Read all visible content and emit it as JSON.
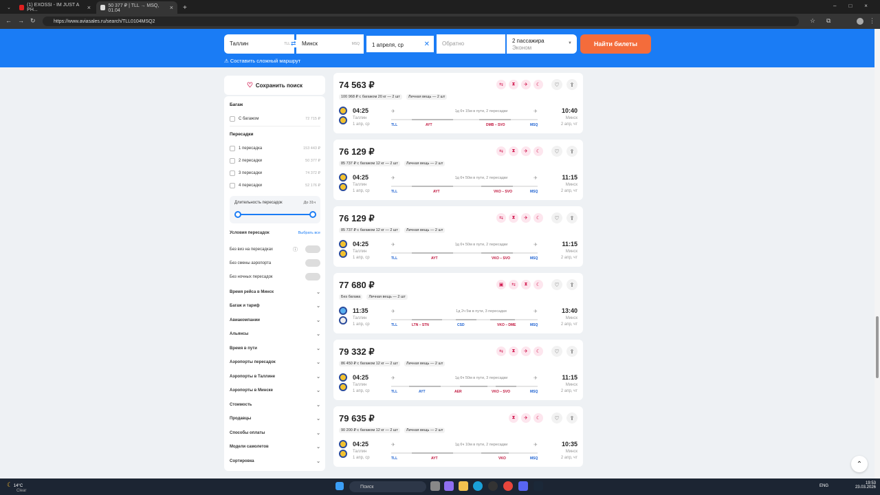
{
  "browser": {
    "tabs": [
      {
        "label": "(1) EXOSSI - IM JUST A PH..."
      },
      {
        "label": "50 377 ₽ | TLL → MSQ, 01.04"
      }
    ],
    "url": "https://www.aviasales.ru/search/TLL0104MSQ2"
  },
  "search": {
    "from": "Таллин",
    "from_code": "TLL",
    "to": "Минск",
    "to_code": "MSQ",
    "date": "1 апреля, ср",
    "return_placeholder": "Обратно",
    "passengers": "2 пассажира",
    "class": "Эконом",
    "button": "Найти билеты",
    "complex": "Составить сложный маршрут"
  },
  "sidebar": {
    "save": "Сохранить поиск",
    "baggage_title": "Багаж",
    "baggage": [
      {
        "label": "С багажом",
        "count": "72 715 ₽"
      }
    ],
    "transfers_title": "Пересадки",
    "transfers": [
      {
        "label": "1 пересадка",
        "count": "153 443 ₽"
      },
      {
        "label": "2 пересадки",
        "count": "50 377 ₽"
      },
      {
        "label": "3 пересадки",
        "count": "74 372 ₽"
      },
      {
        "label": "4 пересадки",
        "count": "52 176 ₽"
      }
    ],
    "duration_label": "Длительность пересадок",
    "duration_value": "До 31ч",
    "conditions_title": "Условия пересадок",
    "select_all": "Выбрать все",
    "conditions": [
      {
        "label": "Без виз на пересадках"
      },
      {
        "label": "Без смены аэропорта"
      },
      {
        "label": "Без ночных пересадок"
      }
    ],
    "sections": [
      "Время рейса в Минск",
      "Багаж и тариф",
      "Авиакомпании",
      "Альянсы",
      "Время в пути",
      "Аэропорты пересадок",
      "Аэропорты в Таллине",
      "Аэропорты в Минске",
      "Стоимость",
      "Продавцы",
      "Способы оплаты",
      "Модели самолетов",
      "Сортировка"
    ]
  },
  "tickets": [
    {
      "price": "74 563 ₽",
      "bag": "100 968 ₽ с багажом 20 кг — 2 шт",
      "hand": "Личная вещь — 2 шт",
      "dep": "04:25",
      "arr": "10:40",
      "city1": "Таллин",
      "city2": "Минск",
      "date1": "1 апр, ср",
      "date2": "2 апр, чт",
      "dur": "1д 6ч 15м в пути, 2 пересадки",
      "ap": [
        "TLL",
        "AYT",
        "DMB – SVO",
        "MSQ"
      ]
    },
    {
      "price": "76 129 ₽",
      "bag": "85 737 ₽ с багажом 12 кг — 2 шт",
      "hand": "Личная вещь — 2 шт",
      "dep": "04:25",
      "arr": "11:15",
      "city1": "Таллин",
      "city2": "Минск",
      "date1": "1 апр, ср",
      "date2": "2 апр, чт",
      "dur": "1д 6ч 50м в пути, 2 пересадки",
      "ap": [
        "TLL",
        "AYT",
        "VKO – SVO",
        "MSQ"
      ]
    },
    {
      "price": "76 129 ₽",
      "bag": "85 737 ₽ с багажом 12 кг — 2 шт",
      "hand": "Личная вещь — 2 шт",
      "dep": "04:25",
      "arr": "11:15",
      "city1": "Таллин",
      "city2": "Минск",
      "date1": "1 апр, ср",
      "date2": "2 апр, чт",
      "dur": "1д 6ч 50м в пути, 2 пересадки",
      "ap": [
        "TLL",
        "AYT",
        "VKO – SVO",
        "MSQ"
      ]
    },
    {
      "price": "77 680 ₽",
      "bag": "Без багажа",
      "hand": "Личная вещь — 2 шт",
      "dep": "11:35",
      "arr": "13:40",
      "city1": "Таллин",
      "city2": "Минск",
      "date1": "1 апр, ср",
      "date2": "2 апр, чт",
      "dur": "1д 2ч 5м в пути, 3 пересадки",
      "ap": [
        "TLL",
        "LTN – STN",
        "CSD",
        "VKO – DME",
        "MSQ"
      ]
    },
    {
      "price": "79 332 ₽",
      "bag": "86 450 ₽ с багажом 12 кг — 2 шт",
      "hand": "Личная вещь — 2 шт",
      "dep": "04:25",
      "arr": "11:15",
      "city1": "Таллин",
      "city2": "Минск",
      "date1": "1 апр, ср",
      "date2": "2 апр, чт",
      "dur": "1д 6ч 50м в пути, 3 пересадки",
      "ap": [
        "TLL",
        "AYT",
        "AER",
        "VKO – SVO",
        "MSQ"
      ]
    },
    {
      "price": "79 635 ₽",
      "bag": "90 200 ₽ с багажом 12 кг — 2 шт",
      "hand": "Личная вещь — 2 шт",
      "dep": "04:25",
      "arr": "10:35",
      "city1": "Таллин",
      "city2": "Минск",
      "date1": "1 апр, ср",
      "date2": "2 апр, чт",
      "dur": "1д 6ч 10м в пути, 2 пересадки",
      "ap": [
        "TLL",
        "AYT",
        "VKO",
        "MSQ"
      ]
    }
  ],
  "taskbar": {
    "temp": "14°C",
    "weather": "Clear",
    "search": "Поиск",
    "lang": "ENG",
    "time": "19:53",
    "date": "23.03.2026"
  }
}
